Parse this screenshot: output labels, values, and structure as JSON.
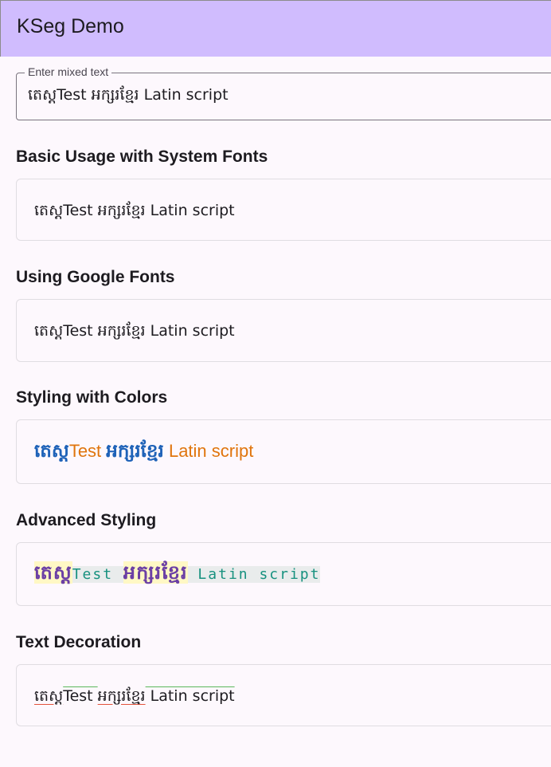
{
  "app_bar": {
    "title": "KSeg Demo"
  },
  "input": {
    "label": "Enter mixed text",
    "value": "តេស្តTest អក្សរខ្មែរ Latin script"
  },
  "sections": [
    {
      "title": "Basic Usage with System Fonts",
      "segments": [
        "តេស្ត",
        "Test ",
        "អក្សរខ្មែរ",
        " Latin script"
      ]
    },
    {
      "title": "Using Google Fonts",
      "segments": [
        "តេស្ត",
        "Test ",
        "អក្សរខ្មែរ",
        " Latin script"
      ]
    },
    {
      "title": "Styling with Colors",
      "segments": [
        "តេស្ត",
        "Test ",
        "អក្សរខ្មែរ",
        " Latin script"
      ],
      "khmer_color": "#1e62b8",
      "latin_color": "#e0750d"
    },
    {
      "title": "Advanced Styling",
      "segments": [
        "តេស្ត",
        "Test ",
        "អក្សរខ្មែរ",
        " Latin script"
      ],
      "khmer_color": "#6b3fa5",
      "khmer_bg": "#fff8c5",
      "latin_color": "#17917f",
      "latin_bg": "#e9ecec"
    },
    {
      "title": "Text Decoration",
      "segments": [
        "តេស្ត",
        "Test ",
        "អក្សរខ្មែរ",
        " Latin script"
      ],
      "khmer_decoration": "underline",
      "latin_decoration": "overline"
    }
  ],
  "colors": {
    "app_bar": "#d0bcfe",
    "background": "#fdf8fd"
  }
}
